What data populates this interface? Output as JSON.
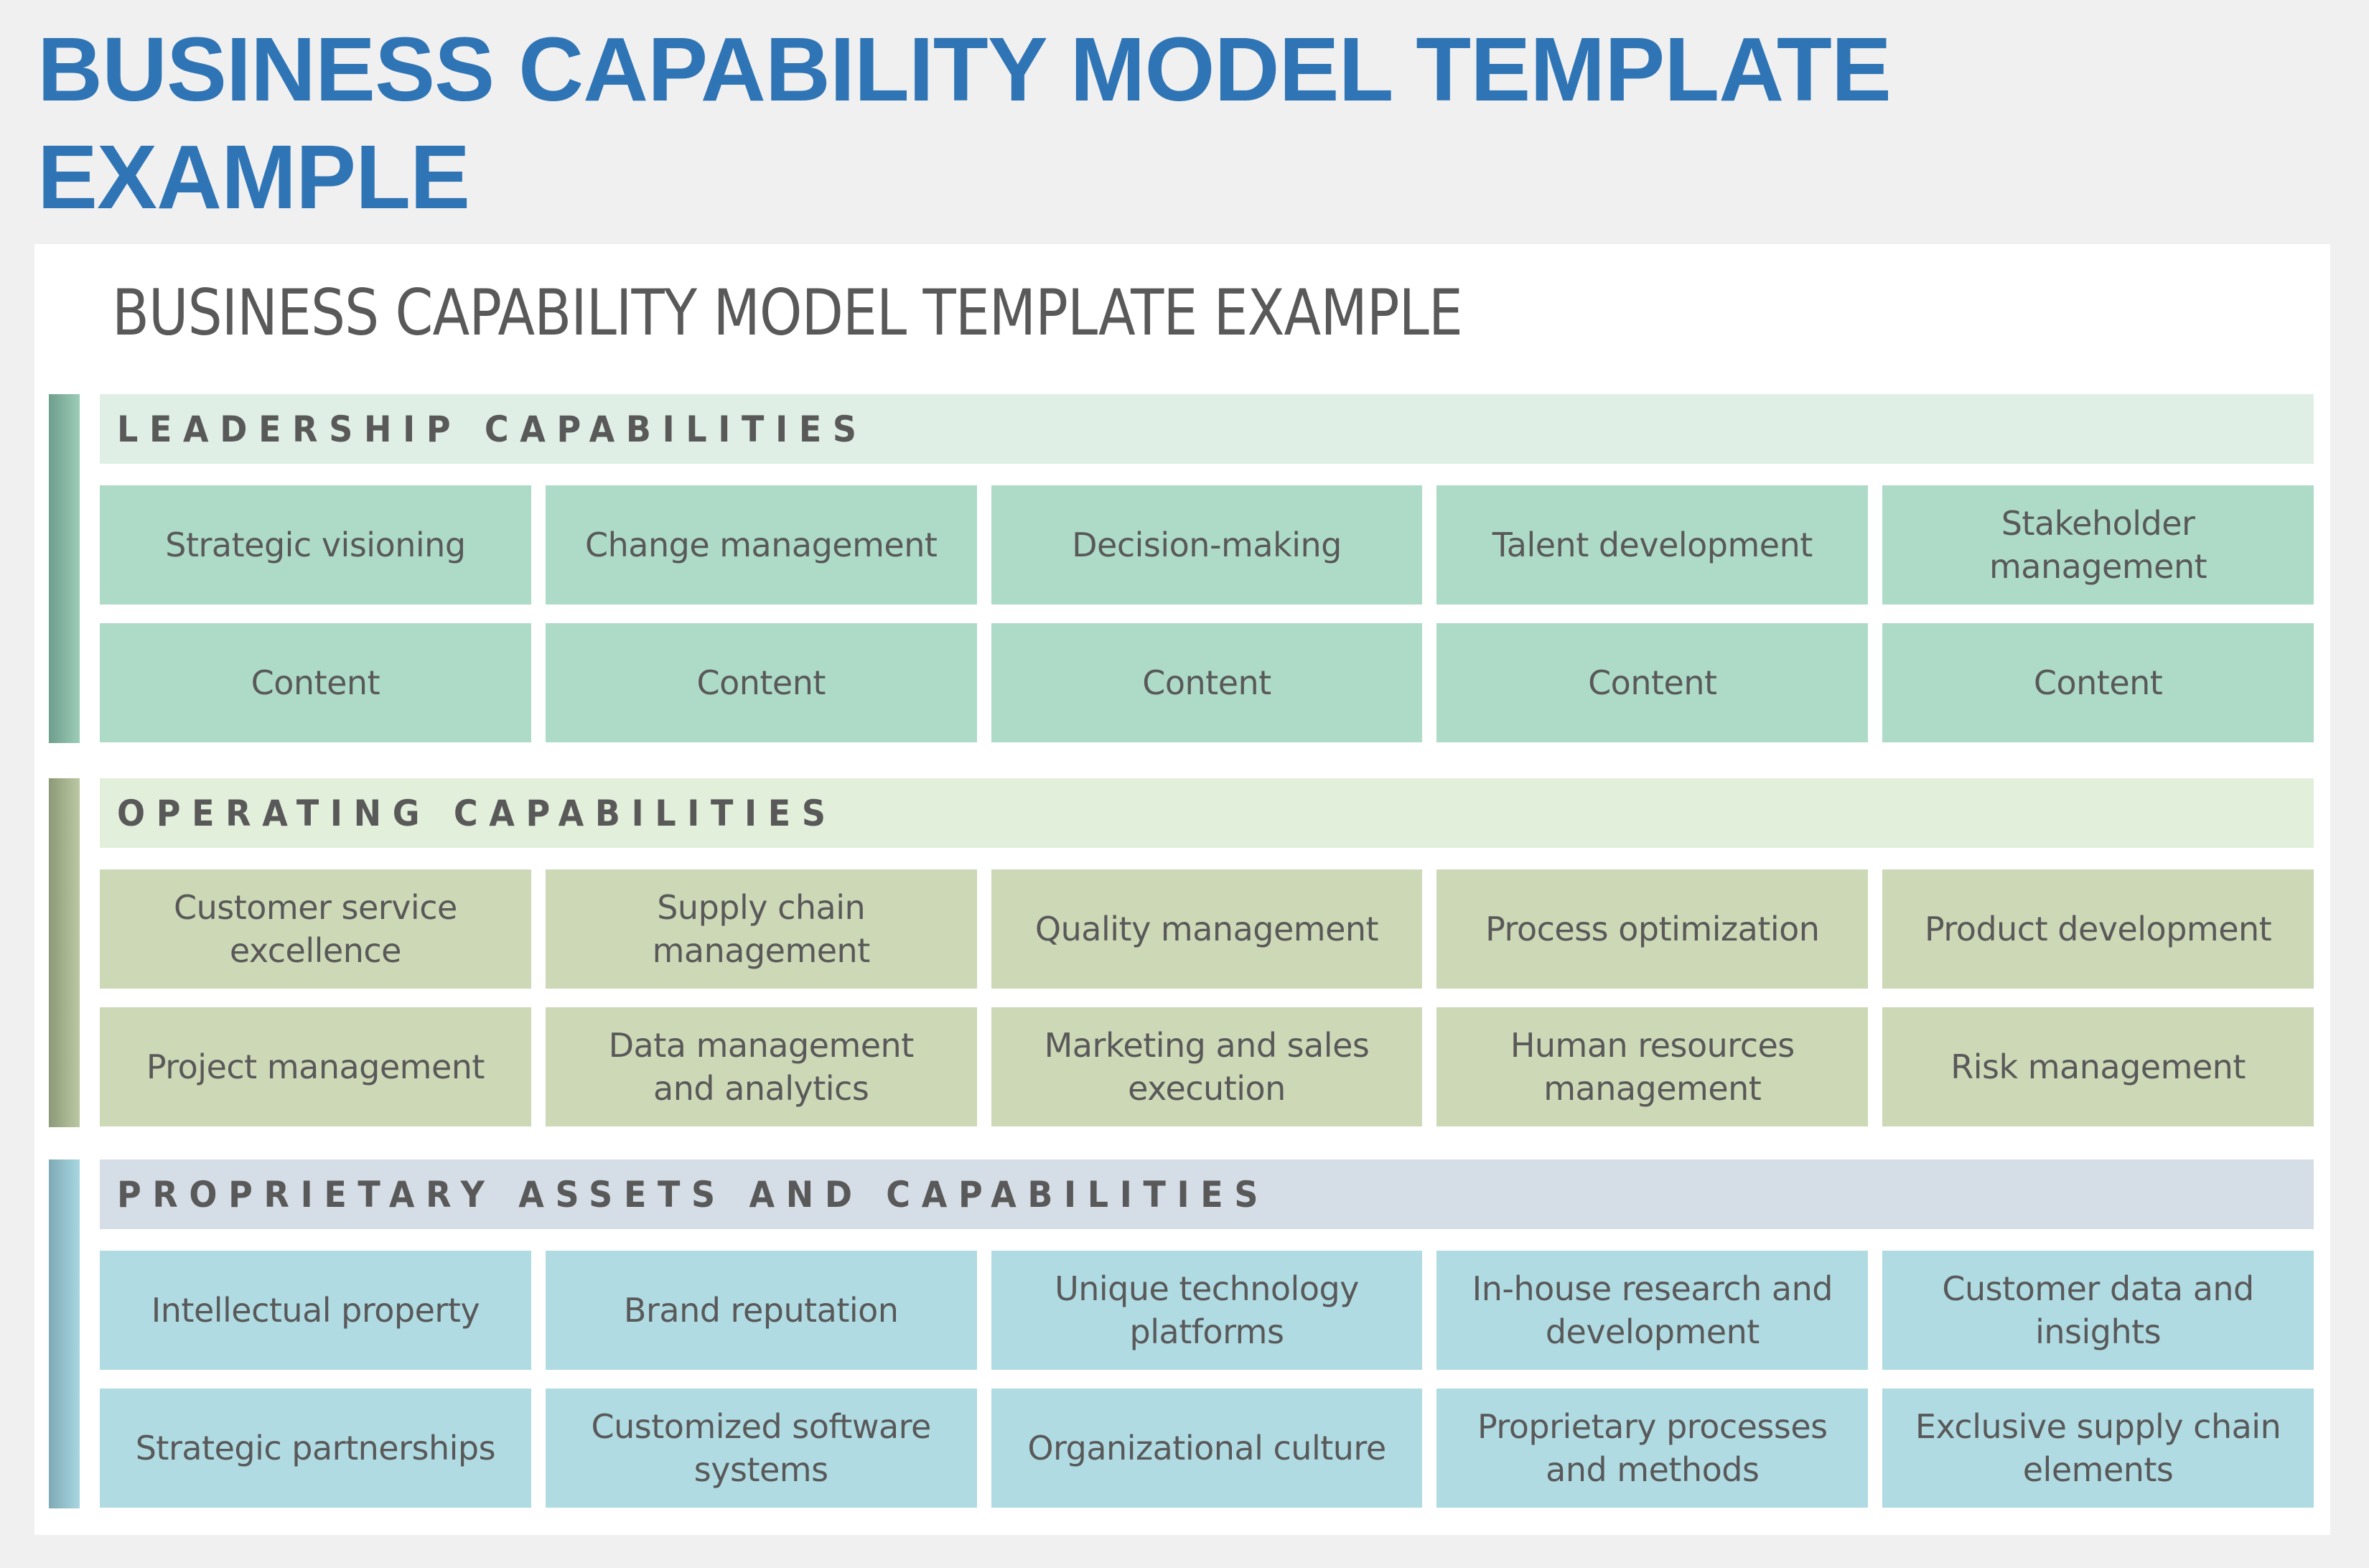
{
  "page": {
    "title": "BUSINESS CAPABILITY MODEL TEMPLATE EXAMPLE"
  },
  "sheet": {
    "title": "BUSINESS CAPABILITY MODEL TEMPLATE EXAMPLE"
  },
  "colors": {
    "title_blue": "#2F75B5",
    "text_gray": "#595959",
    "leadership": {
      "band": "#DFEFE6",
      "tile": "#ADDBC8",
      "accent": "#8BBFA8"
    },
    "operating": {
      "band": "#E2EFDA",
      "tile": "#CCD8B6",
      "accent": "#A7B58F"
    },
    "proprietary": {
      "band": "#D5DDE6",
      "tile": "#B0DBE3",
      "accent": "#96C4CE"
    }
  },
  "sections": [
    {
      "id": "leadership",
      "heading": "LEADERSHIP CAPABILITIES",
      "tiles": [
        "Strategic visioning",
        "Change management",
        "Decision-making",
        "Talent development",
        "Stakeholder management",
        "Content",
        "Content",
        "Content",
        "Content",
        "Content"
      ]
    },
    {
      "id": "operating",
      "heading": "OPERATING CAPABILITIES",
      "tiles": [
        "Customer service excellence",
        "Supply chain management",
        "Quality management",
        "Process optimization",
        "Product development",
        "Project management",
        "Data management and analytics",
        "Marketing and sales execution",
        "Human resources management",
        "Risk management"
      ]
    },
    {
      "id": "proprietary",
      "heading": "PROPRIETARY ASSETS AND CAPABILITIES",
      "tiles": [
        "Intellectual property",
        "Brand reputation",
        "Unique technology platforms",
        "In-house research and development",
        "Customer data and insights",
        "Strategic partnerships",
        "Customized software systems",
        "Organizational culture",
        "Proprietary processes and methods",
        "Exclusive supply chain elements"
      ]
    }
  ]
}
